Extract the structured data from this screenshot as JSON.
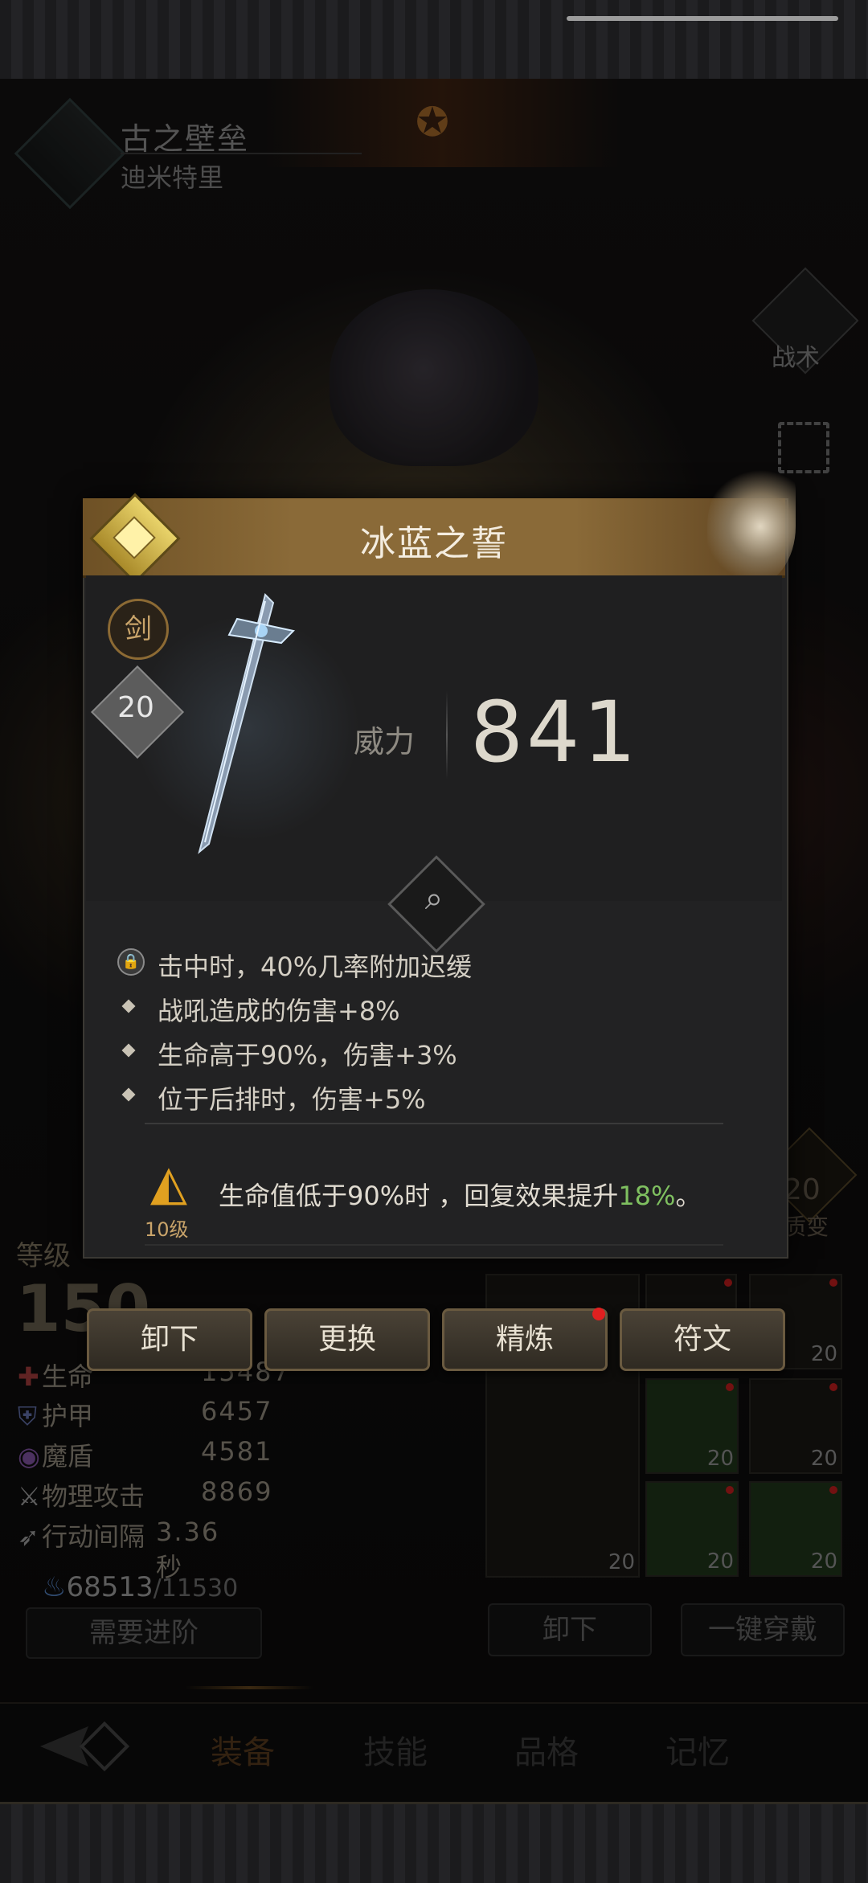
{
  "hero": {
    "name": "古之壁垒",
    "subtitle": "迪米特里"
  },
  "side_icons": {
    "tactics_label": "战术"
  },
  "item": {
    "name": "冰蓝之誓",
    "type_badge": "剑",
    "level": "20",
    "power_label": "威力",
    "power_value": "841",
    "effects": [
      "击中时，40%几率附加迟缓",
      "战吼造成的伤害+8%",
      "生命高于90%，伤害+3%",
      "位于后排时，伤害+5%"
    ],
    "bonus": {
      "level_label": "10级",
      "text_prefix": "生命值低于90%时 ，回复效果提升",
      "text_highlight": "18%",
      "text_suffix": "。"
    }
  },
  "actions": {
    "unequip": "卸下",
    "replace": "更换",
    "refine": "精炼",
    "rune": "符文"
  },
  "left_panel": {
    "level_label": "等级",
    "level_value": "150",
    "stats": [
      {
        "label": "生命",
        "value": "15487"
      },
      {
        "label": "护甲",
        "value": "6457"
      },
      {
        "label": "魔盾",
        "value": "4581"
      },
      {
        "label": "物理攻击",
        "value": "8869"
      },
      {
        "label": "行动间隔",
        "value": "3.36秒"
      }
    ],
    "soul_value": "68513",
    "soul_max": "/11530",
    "advance_button": "需要进阶"
  },
  "equipment": {
    "slot_level": "20",
    "unequip": "卸下",
    "equip_all": "一键穿戴",
    "advance_num": "20",
    "advance_text": "质变"
  },
  "tabs": [
    "装备",
    "技能",
    "品格",
    "记忆"
  ],
  "colors": {
    "accent_gold": "#8a6a38",
    "highlight_green": "#7fc060",
    "red_dot": "#e02020"
  }
}
